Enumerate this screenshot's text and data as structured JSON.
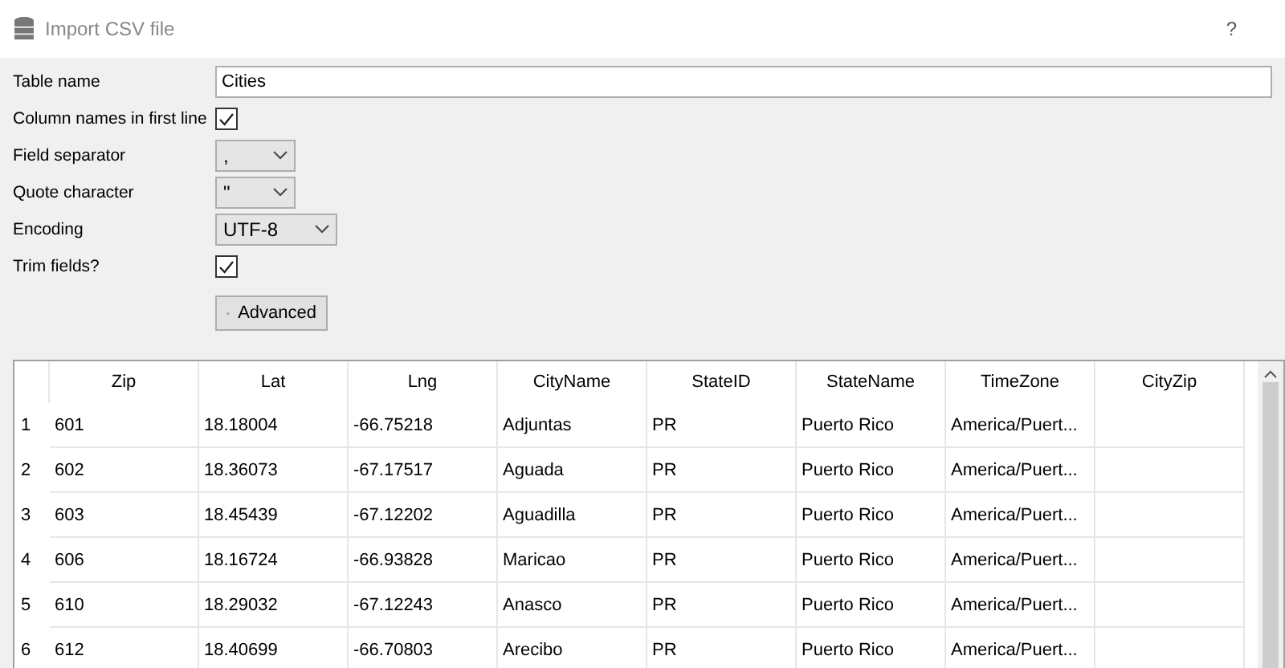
{
  "window": {
    "title": "Import CSV file",
    "help_button": "?"
  },
  "form": {
    "fields": [
      {
        "kind": "text",
        "label": "Table name",
        "value": "Cities"
      },
      {
        "kind": "checkbox",
        "label": "Column names in first line",
        "checked": true
      },
      {
        "kind": "select",
        "label": "Field separator",
        "value": ",",
        "wide": false
      },
      {
        "kind": "select",
        "label": "Quote character",
        "value": "\"",
        "wide": false
      },
      {
        "kind": "select",
        "label": "Encoding",
        "value": "UTF-8",
        "wide": true
      },
      {
        "kind": "checkbox",
        "label": "Trim fields?",
        "checked": true
      }
    ],
    "advanced_button": "Advanced"
  },
  "table": {
    "columns": [
      "Zip",
      "Lat",
      "Lng",
      "CityName",
      "StateID",
      "StateName",
      "TimeZone",
      "CityZip"
    ],
    "rows": [
      {
        "number": "1",
        "cells": [
          "601",
          "18.18004",
          "-66.75218",
          "Adjuntas",
          "PR",
          "Puerto Rico",
          "America/Puert...",
          ""
        ]
      },
      {
        "number": "2",
        "cells": [
          "602",
          "18.36073",
          "-67.17517",
          "Aguada",
          "PR",
          "Puerto Rico",
          "America/Puert...",
          ""
        ]
      },
      {
        "number": "3",
        "cells": [
          "603",
          "18.45439",
          "-67.12202",
          "Aguadilla",
          "PR",
          "Puerto Rico",
          "America/Puert...",
          ""
        ]
      },
      {
        "number": "4",
        "cells": [
          "606",
          "18.16724",
          "-66.93828",
          "Maricao",
          "PR",
          "Puerto Rico",
          "America/Puert...",
          ""
        ]
      },
      {
        "number": "5",
        "cells": [
          "610",
          "18.29032",
          "-67.12243",
          "Anasco",
          "PR",
          "Puerto Rico",
          "America/Puert...",
          ""
        ]
      },
      {
        "number": "6",
        "cells": [
          "612",
          "18.40699",
          "-66.70803",
          "Arecibo",
          "PR",
          "Puerto Rico",
          "America/Puert...",
          ""
        ]
      }
    ]
  }
}
